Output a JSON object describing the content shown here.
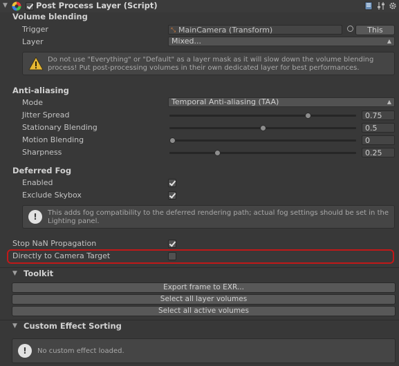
{
  "component": {
    "title": "Post Process Layer (Script)",
    "enabled": true
  },
  "volume_blending": {
    "header": "Volume blending",
    "trigger_label": "Trigger",
    "trigger_value": "MainCamera (Transform)",
    "this_button": "This",
    "layer_label": "Layer",
    "layer_value": "Mixed...",
    "warning": "Do not use \"Everything\" or \"Default\" as a layer mask as it will slow down the volume blending process! Put post-processing volumes in their own dedicated layer for best performances."
  },
  "anti_aliasing": {
    "header": "Anti-aliasing",
    "mode_label": "Mode",
    "mode_value": "Temporal Anti-aliasing (TAA)",
    "sliders": [
      {
        "label": "Jitter Spread",
        "value_text": "0.75",
        "value": 0.75,
        "min": 0,
        "max": 1
      },
      {
        "label": "Stationary Blending",
        "value_text": "0.5",
        "value": 0.5,
        "min": 0,
        "max": 1
      },
      {
        "label": "Motion Blending",
        "value_text": "0",
        "value": 0,
        "min": 0,
        "max": 1
      },
      {
        "label": "Sharpness",
        "value_text": "0.25",
        "value": 0.25,
        "min": 0,
        "max": 1
      }
    ]
  },
  "deferred_fog": {
    "header": "Deferred Fog",
    "enabled_label": "Enabled",
    "enabled": true,
    "exclude_skybox_label": "Exclude Skybox",
    "exclude_skybox": true,
    "info": "This adds fog compatibility to the deferred rendering path; actual fog settings should be set in the Lighting panel."
  },
  "misc": {
    "stop_nan_label": "Stop NaN Propagation",
    "stop_nan": true,
    "direct_camera_label": "Directly to Camera Target",
    "direct_camera": false
  },
  "toolkit": {
    "header": "Toolkit",
    "buttons": [
      "Export frame to EXR...",
      "Select all layer volumes",
      "Select all active volumes"
    ]
  },
  "custom_sorting": {
    "header": "Custom Effect Sorting",
    "message": "No custom effect loaded."
  },
  "colors": {
    "highlight": "#c21818",
    "background": "#383838"
  }
}
